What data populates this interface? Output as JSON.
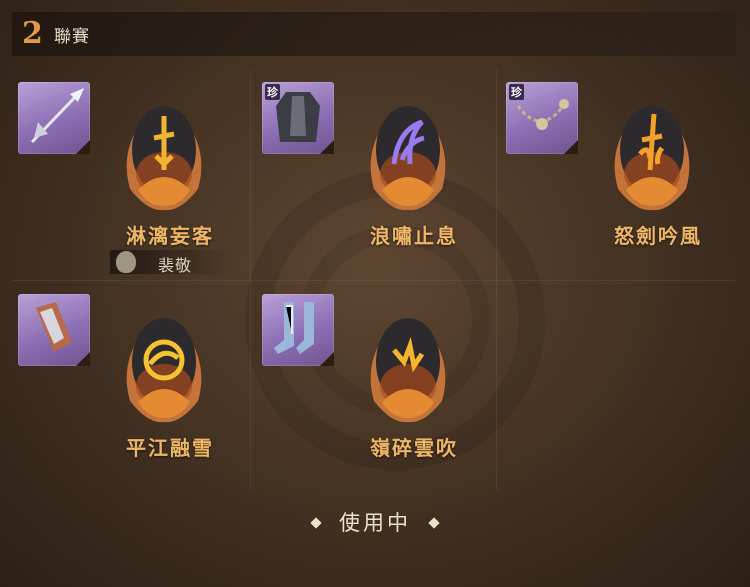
{
  "header": {
    "number": "2",
    "title": "聯賽"
  },
  "items": [
    {
      "name": "淋漓妄客",
      "equip_icon": "spear-icon",
      "rare_badge": "",
      "rune_icon": "sword-rune-icon",
      "rune_color": "#f3b431",
      "follower": "裴敬"
    },
    {
      "name": "浪嘯止息",
      "equip_icon": "armor-icon",
      "rare_badge": "珍",
      "rune_icon": "wave-rune-icon",
      "rune_color": "#9a7af0",
      "follower": ""
    },
    {
      "name": "怒劍吟風",
      "equip_icon": "bead-chain-icon",
      "rare_badge": "珍",
      "rune_icon": "sword-rune-icon",
      "rune_color": "#f3a12a",
      "follower": ""
    },
    {
      "name": "平江融雪",
      "equip_icon": "bracer-icon",
      "rare_badge": "",
      "rune_icon": "swirl-rune-icon",
      "rune_color": "#f5c232",
      "follower": ""
    },
    {
      "name": "嶺碎雲吹",
      "equip_icon": "boots-icon",
      "rare_badge": "",
      "rune_icon": "lightning-rune-icon",
      "rune_color": "#f5b52e",
      "follower": ""
    }
  ],
  "status": {
    "label": "使用中"
  }
}
